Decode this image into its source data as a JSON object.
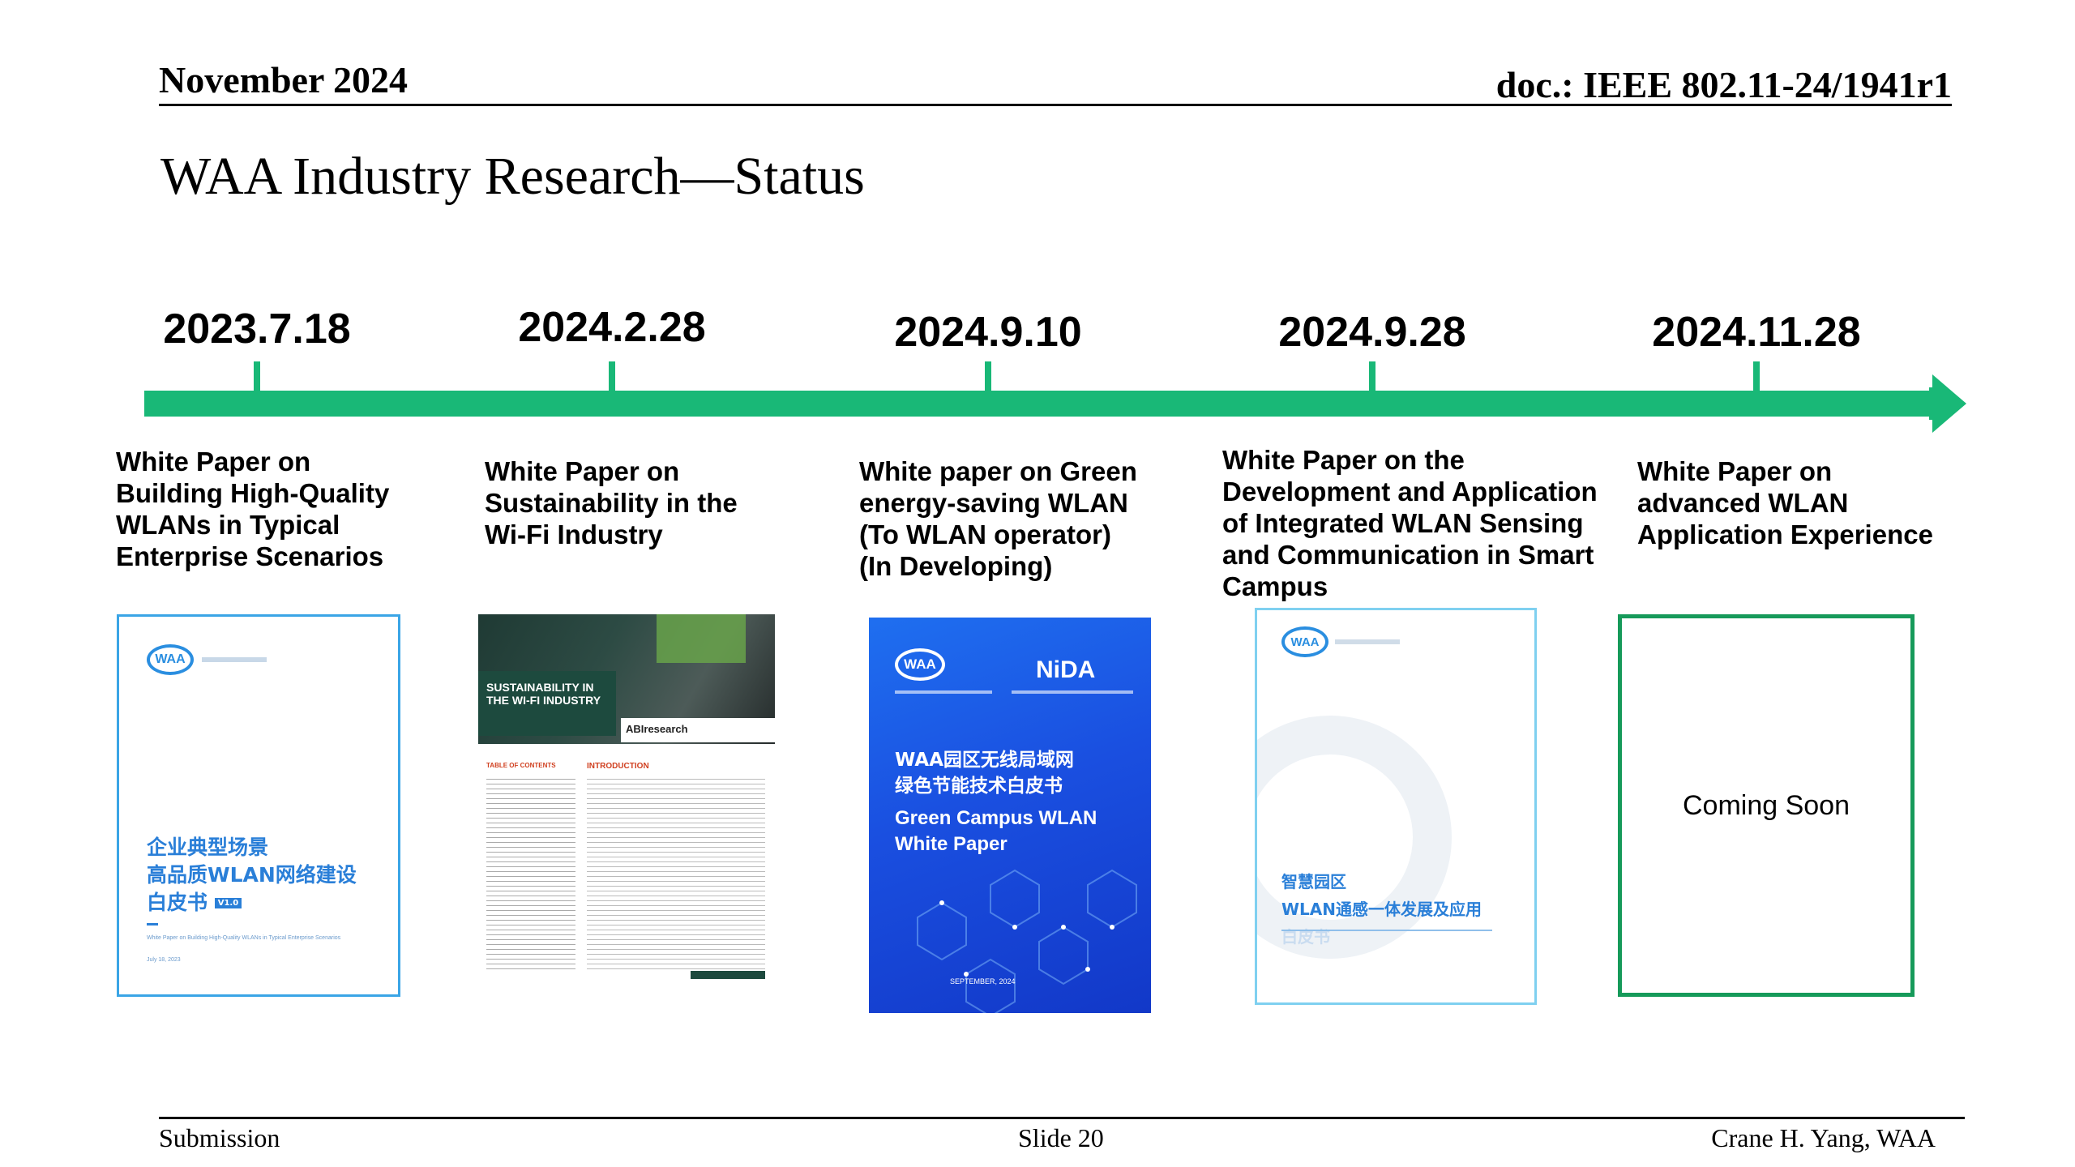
{
  "header": {
    "date": "November 2024",
    "doc": "doc.: IEEE 802.11-24/1941r1"
  },
  "title": "WAA Industry Research—Status",
  "colors": {
    "timeline": "#19b877",
    "cover1_border": "#3aa5e6",
    "cover5_border": "#169a5a"
  },
  "milestones": [
    {
      "date": "2023.7.18",
      "desc": [
        "White Paper on",
        "Building High-Quality",
        "WLANs in Typical",
        "Enterprise Scenarios"
      ]
    },
    {
      "date": "2024.2.28",
      "desc": [
        "White Paper on",
        "Sustainability in the",
        "Wi-Fi Industry"
      ]
    },
    {
      "date": "2024.9.10",
      "desc": [
        "White paper on Green",
        "energy-saving WLAN",
        "(To WLAN operator)",
        "(In Developing)"
      ]
    },
    {
      "date": "2024.9.28",
      "desc": [
        "White Paper on the",
        "Development and Application",
        "of Integrated WLAN Sensing",
        "and Communication in Smart",
        "Campus"
      ]
    },
    {
      "date": "2024.11.28",
      "desc": [
        "White Paper on",
        "advanced WLAN",
        "Application Experience"
      ]
    }
  ],
  "covers": {
    "c1": {
      "logo": "WAA",
      "title_zh": [
        "企业典型场景",
        "高品质WLAN网络建设",
        "白皮书"
      ],
      "badge": "V1.0",
      "subtitle": "White Paper on Building High-Quality WLANs in Typical Enterprise Scenarios",
      "date": "July 18, 2023"
    },
    "c2": {
      "banner": "SUSTAINABILITY IN THE WI-FI INDUSTRY",
      "brand": "ABIresearch",
      "toc": "TABLE OF CONTENTS",
      "intro": "INTRODUCTION"
    },
    "c3": {
      "logo": "WAA",
      "partner": "NiDA",
      "title_zh": [
        "WAA园区无线局域网",
        "绿色节能技术白皮书"
      ],
      "title_en": [
        "Green Campus WLAN",
        "White Paper"
      ],
      "date": "SEPTEMBER, 2024"
    },
    "c4": {
      "logo": "WAA",
      "title_zh": [
        "智慧园区",
        "WLAN通感一体发展及应用",
        "白皮书"
      ]
    },
    "c5": {
      "text": "Coming Soon"
    }
  },
  "footer": {
    "left": "Submission",
    "center": "Slide 20",
    "right": "Crane H. Yang, WAA"
  }
}
